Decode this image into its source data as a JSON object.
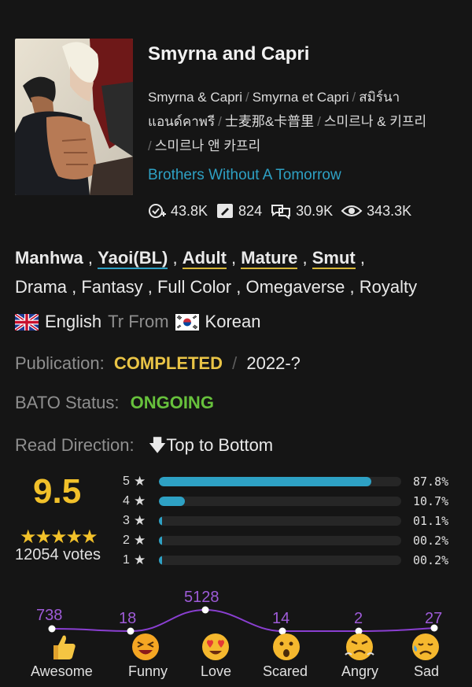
{
  "title": "Smyrna and Capri",
  "alt_titles": [
    "Smyrna & Capri",
    "Smyrna et Capri",
    "สมิร์นา",
    "แอนด์คาพรี",
    "士麦那&卡普里",
    "스미르나 & 키프리",
    "스미르나 앤 카프리"
  ],
  "author": "Brothers Without A Tomorrow",
  "stats": {
    "follows": "43.8K",
    "reviews": "824",
    "comments": "30.9K",
    "views": "343.3K"
  },
  "genres_bold": [
    "Manhwa",
    "Yaoi(BL)",
    "Adult",
    "Mature",
    "Smut"
  ],
  "genres": [
    "Drama",
    "Fantasy",
    "Full Color",
    "Omegaverse",
    "Royalty"
  ],
  "language": {
    "from_lang": "English",
    "tr_from": "Tr From",
    "to_lang": "Korean"
  },
  "publication": {
    "label": "Publication:",
    "status": "COMPLETED",
    "years": "2022-?"
  },
  "bato": {
    "label": "BATO Status:",
    "status": "ONGOING"
  },
  "direction": {
    "label": "Read Direction:",
    "value": "Top to Bottom"
  },
  "rating": {
    "score": "9.5",
    "votes": "12054 votes",
    "distribution": [
      {
        "star": "5",
        "pct": "87.8%",
        "value": 87.8
      },
      {
        "star": "4",
        "pct": "10.7%",
        "value": 10.7
      },
      {
        "star": "3",
        "pct": "01.1%",
        "value": 1.1
      },
      {
        "star": "2",
        "pct": "00.2%",
        "value": 0.2
      },
      {
        "star": "1",
        "pct": "00.2%",
        "value": 0.2
      }
    ]
  },
  "reactions": [
    {
      "label": "Awesome",
      "count": "738"
    },
    {
      "label": "Funny",
      "count": "18"
    },
    {
      "label": "Love",
      "count": "5128"
    },
    {
      "label": "Scared",
      "count": "14"
    },
    {
      "label": "Angry",
      "count": "2"
    },
    {
      "label": "Sad",
      "count": "27"
    }
  ],
  "colors": {
    "accent_blue": "#2ea1c4",
    "gold": "#e9c446",
    "green": "#67c13c",
    "purple": "#9e5bd8"
  }
}
